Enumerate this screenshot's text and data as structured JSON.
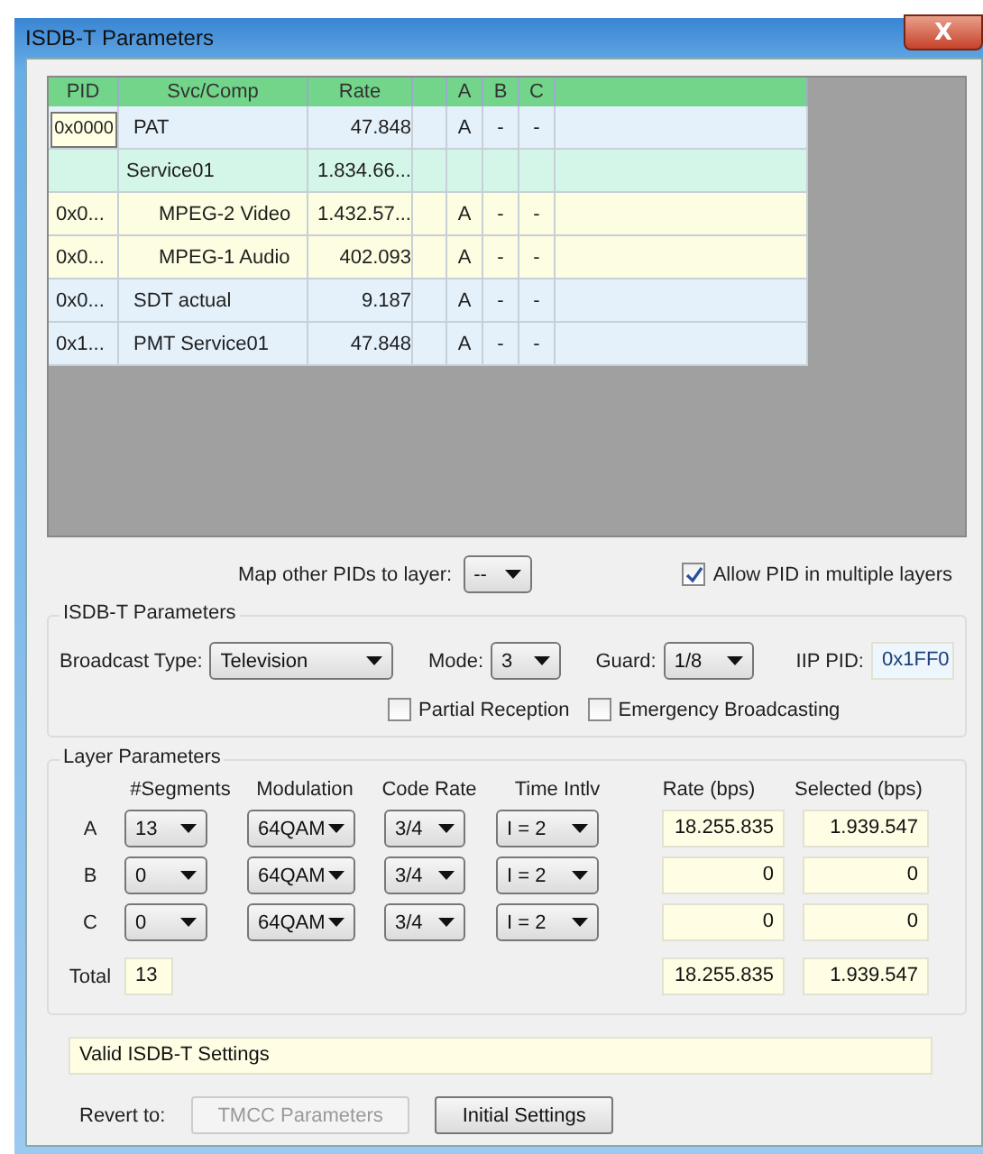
{
  "window": {
    "title": "ISDB-T Parameters",
    "close": "X"
  },
  "table": {
    "columns": [
      "PID",
      "Svc/Comp",
      "Rate",
      "",
      "A",
      "B",
      "C"
    ],
    "tooltip": "0x0000",
    "rows": [
      {
        "kind": "table",
        "pid": "",
        "name": "PAT",
        "rate": "47.848",
        "layers": [
          "A",
          "-",
          "-"
        ]
      },
      {
        "kind": "service",
        "pid": "",
        "name": "Service01",
        "rate": "1.834.66...",
        "children": [
          {
            "kind": "component",
            "pid": "0x0...",
            "name": "MPEG-2 Video",
            "rate": "1.432.57...",
            "layers": [
              "A",
              "-",
              "-"
            ]
          },
          {
            "kind": "component",
            "pid": "0x0...",
            "name": "MPEG-1 Audio",
            "rate": "402.093",
            "layers": [
              "A",
              "-",
              "-"
            ]
          }
        ]
      },
      {
        "kind": "table",
        "pid": "0x0...",
        "name": "SDT actual",
        "rate": "9.187",
        "layers": [
          "A",
          "-",
          "-"
        ]
      },
      {
        "kind": "table",
        "pid": "0x1...",
        "name": "PMT Service01",
        "rate": "47.848",
        "layers": [
          "A",
          "-",
          "-"
        ]
      }
    ]
  },
  "map_layer": {
    "label": "Map other PIDs to layer:",
    "value": "--"
  },
  "allow_multiple": {
    "label": "Allow PID in multiple layers",
    "checked": true
  },
  "isdbt": {
    "title": "ISDB-T Parameters",
    "broadcast_type": {
      "label": "Broadcast Type:",
      "value": "Television"
    },
    "mode": {
      "label": "Mode:",
      "value": "3"
    },
    "guard": {
      "label": "Guard:",
      "value": "1/8"
    },
    "iip_pid": {
      "label": "IIP PID:",
      "value": "0x1FF0"
    },
    "checkboxes": [
      {
        "label": "Partial Reception",
        "checked": false
      },
      {
        "label": "Emergency Broadcasting",
        "checked": false
      }
    ]
  },
  "layers": {
    "title": "Layer Parameters",
    "columns": [
      "#Segments",
      "Modulation",
      "Code Rate",
      "Time Intlv",
      "Rate (bps)",
      "Selected (bps)"
    ],
    "rows": [
      {
        "name": "A",
        "segments": "13",
        "modulation": "64QAM",
        "code_rate": "3/4",
        "interleave": "I = 2",
        "rate": "18.255.835",
        "selected": "1.939.547"
      },
      {
        "name": "B",
        "segments": "0",
        "modulation": "64QAM",
        "code_rate": "3/4",
        "interleave": "I = 2",
        "rate": "0",
        "selected": "0"
      },
      {
        "name": "C",
        "segments": "0",
        "modulation": "64QAM",
        "code_rate": "3/4",
        "interleave": "I = 2",
        "rate": "0",
        "selected": "0"
      }
    ],
    "total": {
      "label": "Total",
      "segments": "13",
      "rate": "18.255.835",
      "selected": "1.939.547"
    }
  },
  "status": "Valid ISDB-T Settings",
  "revert": {
    "label": "Revert to:",
    "buttons": [
      {
        "label": "TMCC Parameters",
        "disabled": true
      },
      {
        "label": "Initial Settings",
        "disabled": false
      }
    ]
  }
}
